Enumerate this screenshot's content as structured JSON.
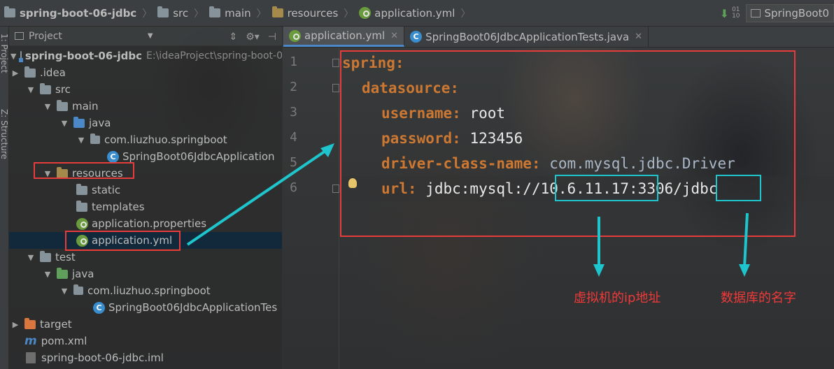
{
  "navbar": {
    "project": "spring-boot-06-jdbc",
    "crumbs": [
      "src",
      "main",
      "resources",
      "application.yml"
    ],
    "run_config": "SpringBoot0"
  },
  "toolstrip": {
    "project_label": "1: Project",
    "structure_label": "Z: Structure"
  },
  "project_panel": {
    "title": "Project",
    "tree": [
      {
        "label": "spring-boot-06-jdbc",
        "path": "E:\\ideaProject\\spring-boot-0"
      },
      {
        "label": ".idea"
      },
      {
        "label": "src"
      },
      {
        "label": "main"
      },
      {
        "label": "java"
      },
      {
        "label": "com.liuzhuo.springboot"
      },
      {
        "label": "SpringBoot06JdbcApplication"
      },
      {
        "label": "resources"
      },
      {
        "label": "static"
      },
      {
        "label": "templates"
      },
      {
        "label": "application.properties"
      },
      {
        "label": "application.yml"
      },
      {
        "label": "test"
      },
      {
        "label": "java"
      },
      {
        "label": "com.liuzhuo.springboot"
      },
      {
        "label": "SpringBoot06JdbcApplicationTes"
      },
      {
        "label": "target"
      },
      {
        "label": "pom.xml"
      },
      {
        "label": "spring-boot-06-jdbc.iml"
      }
    ]
  },
  "editor": {
    "tabs": [
      {
        "label": "application.yml",
        "active": true
      },
      {
        "label": "SpringBoot06JdbcApplicationTests.java",
        "active": false
      }
    ],
    "line_numbers": [
      "1",
      "2",
      "3",
      "4",
      "5",
      "6"
    ],
    "lines": [
      {
        "key": "spring:",
        "value": ""
      },
      {
        "key": "datasource:",
        "value": ""
      },
      {
        "key": "username:",
        "value": " root"
      },
      {
        "key": "password:",
        "value": " 123456"
      },
      {
        "key": "driver-class-name:",
        "value": " com.mysql.jdbc.Driver"
      },
      {
        "key": "url:",
        "value_prefix": " jdbc:mysql://",
        "ip": "10.6.11.17",
        "mid": ":3306/",
        "db": "jdbc"
      }
    ]
  },
  "annotations": {
    "ip_label": "虚拟机的ip地址",
    "db_label": "数据库的名字"
  },
  "colors": {
    "highlight_red": "#e63c3c",
    "highlight_cyan": "#1fc5cc",
    "yaml_key": "#cc7832",
    "selection": "#0d293e"
  }
}
